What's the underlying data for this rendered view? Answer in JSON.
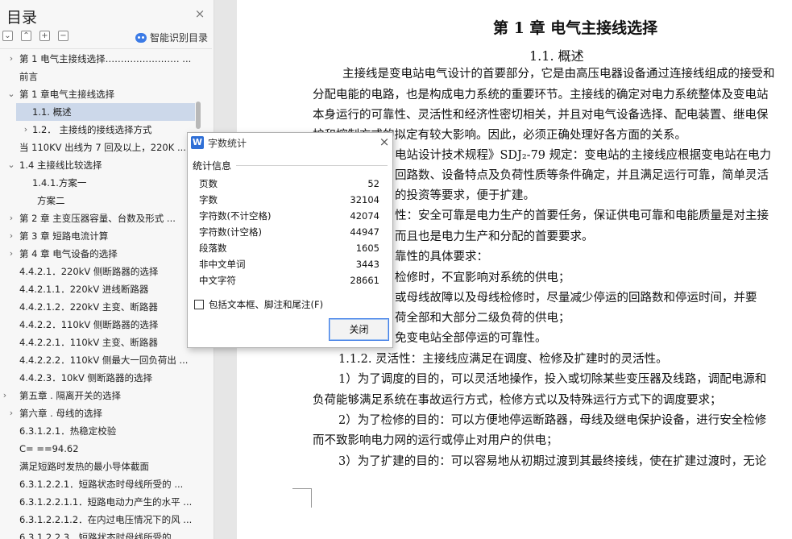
{
  "sidebar": {
    "title": "目录",
    "close_icon": "close-icon",
    "smart_label": "智能识别目录",
    "toc": [
      {
        "arrow": "›",
        "text": "第 1  电气主接线选择…………………… ..."
      },
      {
        "arrow": "",
        "text": "前言"
      },
      {
        "arrow": "⌄",
        "text": "第 1 章电气主接线选择"
      },
      {
        "arrow": "",
        "text": "1.1.   概述"
      },
      {
        "arrow": "›",
        "text": "1.2．   主接线的接线选择方式"
      },
      {
        "arrow": "",
        "text": "当 110KV 出线为 7 回及以上，220K ..."
      },
      {
        "arrow": "⌄",
        "text": "1.4  主接线比较选择"
      },
      {
        "arrow": "",
        "text": "1.4.1.方案一"
      },
      {
        "arrow": "",
        "text": "方案二"
      },
      {
        "arrow": "›",
        "text": "第 2 章   主变压器容量、台数及形式 ..."
      },
      {
        "arrow": "›",
        "text": "第 3 章    短路电流计算"
      },
      {
        "arrow": "›",
        "text": "第 4 章    电气设备的选择"
      },
      {
        "arrow": "",
        "text": "4.4.2.1．220kV 侧断路器的选择"
      },
      {
        "arrow": "",
        "text": "4.4.2.1.1．220kV 进线断路器"
      },
      {
        "arrow": "",
        "text": "4.4.2.1.2．220kV 主变、断路器"
      },
      {
        "arrow": "",
        "text": "4.4.2.2．110kV 侧断路器的选择"
      },
      {
        "arrow": "",
        "text": "4.4.2.2.1．110kV 主变、断路器"
      },
      {
        "arrow": "",
        "text": "4.4.2.2.2．110kV 侧最大一回负荷出 ..."
      },
      {
        "arrow": "",
        "text": "4.4.2.3．10kV 侧断路器的选择"
      },
      {
        "arrow": "›",
        "text": "第五章   . 隔离开关的选择"
      },
      {
        "arrow": "›",
        "text": "第六章   . 母线的选择"
      },
      {
        "arrow": "",
        "text": "6.3.1.2.1．热稳定校验"
      },
      {
        "arrow": "",
        "text": "C= ==94.62"
      },
      {
        "arrow": "",
        "text": "满足短路时发热的最小导体截面"
      },
      {
        "arrow": "",
        "text": "6.3.1.2.2.1．短路状态时母线所受的 ..."
      },
      {
        "arrow": "",
        "text": "6.3.1.2.2.1.1．短路电动力产生的水平 ..."
      },
      {
        "arrow": "",
        "text": "6.3.1.2.2.1.2．在内过电压情况下的风 ..."
      },
      {
        "arrow": "",
        "text": "6.3.1.2.2.3．短路状态时母线所受的 ..."
      }
    ]
  },
  "document": {
    "chapter_title": "第 1 章   电气主接线选择",
    "section_title": "1.1.   概述",
    "lines": [
      "主接线是变电站电气设计的首要部分，它是由高压电器设备通过连接线组成的接受和",
      "分配电能的电路，也是构成电力系统的重要环节。主接线的确定对电力系统整体及变电站",
      "本身运行的可靠性、灵活性和经济性密切相关，并且对电气设备选择、配电装置、继电保",
      "护和控制方式的拟定有较大影响。因此，必须正确处理好各方面的关系。",
      "电站设计技术规程》SDJ₂-79 规定：变电站的主接线应根据变电站在电力",
      "回路数、设备特点及负荷性质等条件确定，并且满足运行可靠，简单灵活",
      "的投资等要求，便于扩建。",
      "性：安全可靠是电力生产的首要任务，保证供电可靠和电能质量是对主接",
      "而且也是电力生产和分配的首要要求。",
      "靠性的具体要求：",
      "检修时，不宜影响对系统的供电；",
      "或母线故障以及母线检修时，尽量减少停运的回路数和停运时间，并要",
      "荷全部和大部分二级负荷的供电；",
      "免变电站全部停运的可靠性。",
      "1.1.2.  灵活性：主接线应满足在调度、检修及扩建时的灵活性。",
      "1）为了调度的目的，可以灵活地操作，投入或切除某些变压器及线路，调配电源和",
      "负荷能够满足系统在事故运行方式，检修方式以及特殊运行方式下的调度要求；",
      "2）为了检修的目的：可以方便地停运断路器，母线及继电保护设备，进行安全检修",
      "而不致影响电力网的运行或停止对用户的供电；",
      "3）为了扩建的目的：可以容易地从初期过渡到其最终接线，使在扩建过渡时，无论"
    ]
  },
  "dialog": {
    "title": "字数统计",
    "section": "统计信息",
    "stats": [
      {
        "label": "页数",
        "value": "52"
      },
      {
        "label": "字数",
        "value": "32104"
      },
      {
        "label": "字符数(不计空格)",
        "value": "42074"
      },
      {
        "label": "字符数(计空格)",
        "value": "44947"
      },
      {
        "label": "段落数",
        "value": "1605"
      },
      {
        "label": "非中文单词",
        "value": "3443"
      },
      {
        "label": "中文字符",
        "value": "28661"
      }
    ],
    "checkbox_label": "包括文本框、脚注和尾注(F)",
    "close_button": "关闭"
  }
}
